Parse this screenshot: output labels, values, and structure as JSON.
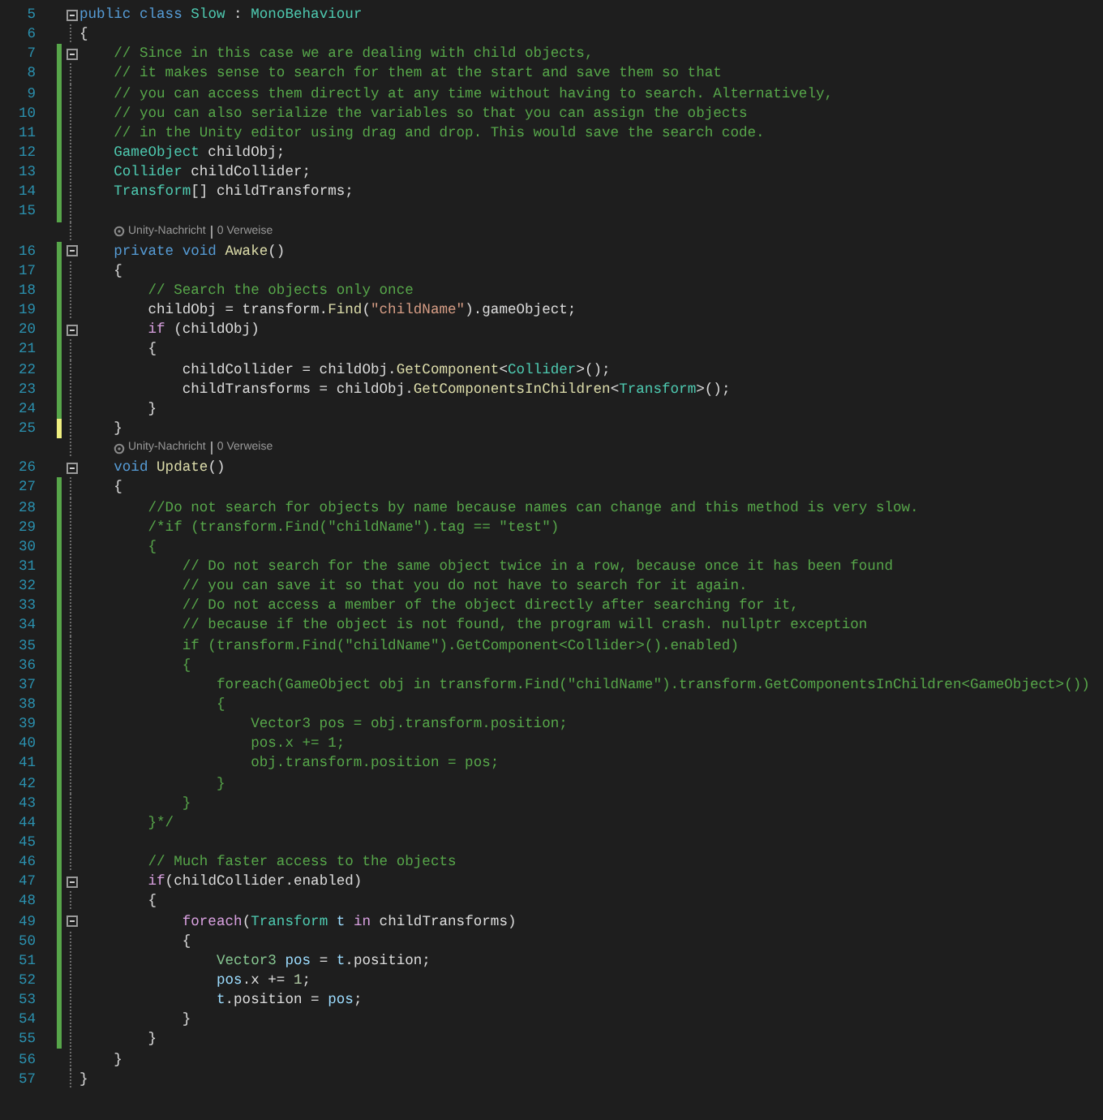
{
  "editor": {
    "rows": [
      {
        "kind": "code",
        "number": "5",
        "fold": true,
        "tokens": [
          {
            "kind": "keyword",
            "text": "public class "
          },
          {
            "kind": "type",
            "text": "Slow"
          },
          {
            "kind": "plain",
            "text": " : "
          },
          {
            "kind": "type",
            "text": "MonoBehaviour"
          }
        ]
      },
      {
        "kind": "code",
        "number": "6",
        "fold": false,
        "tokens": [
          {
            "kind": "plain",
            "text": "{"
          }
        ]
      },
      {
        "kind": "code",
        "number": "7",
        "fold": true,
        "color": "#57a64a",
        "tokens": [
          {
            "kind": "comment",
            "text": "    // Since in this case we are dealing with child objects,"
          }
        ]
      },
      {
        "kind": "code",
        "number": "8",
        "fold": false,
        "color": "#57a64a",
        "tokens": [
          {
            "kind": "comment",
            "text": "    // it makes sense to search for them at the start and save them so that"
          }
        ]
      },
      {
        "kind": "code",
        "number": "9",
        "fold": false,
        "color": "#57a64a",
        "tokens": [
          {
            "kind": "comment",
            "text": "    // you can access them directly at any time without having to search. Alternatively,"
          }
        ]
      },
      {
        "kind": "code",
        "number": "10",
        "fold": false,
        "color": "#57a64a",
        "tokens": [
          {
            "kind": "comment",
            "text": "    // you can also serialize the variables so that you can assign the objects"
          }
        ]
      },
      {
        "kind": "code",
        "number": "11",
        "fold": false,
        "color": "#57a64a",
        "tokens": [
          {
            "kind": "comment",
            "text": "    // in the Unity editor using drag and drop. This would save the search code."
          }
        ]
      },
      {
        "kind": "code",
        "number": "12",
        "fold": false,
        "color": "#57a64a",
        "tokens": [
          {
            "kind": "type",
            "text": "    GameObject"
          },
          {
            "kind": "plain",
            "text": " childObj;"
          }
        ]
      },
      {
        "kind": "code",
        "number": "13",
        "fold": false,
        "color": "#57a64a",
        "tokens": [
          {
            "kind": "type",
            "text": "    Collider"
          },
          {
            "kind": "plain",
            "text": " childCollider;"
          }
        ]
      },
      {
        "kind": "code",
        "number": "14",
        "fold": false,
        "color": "#57a64a",
        "tokens": [
          {
            "kind": "type",
            "text": "    Transform"
          },
          {
            "kind": "plain",
            "text": "[] childTransforms;"
          }
        ]
      },
      {
        "kind": "code",
        "number": "15",
        "fold": false,
        "color": "#57a64a",
        "tokens": []
      },
      {
        "kind": "codelens",
        "source": "Unity-Nachricht",
        "references": "0 Verweise"
      },
      {
        "kind": "code",
        "number": "16",
        "fold": true,
        "color": "#57a64a",
        "tokens": [
          {
            "kind": "keyword",
            "text": "    private void "
          },
          {
            "kind": "method",
            "text": "Awake"
          },
          {
            "kind": "plain",
            "text": "()"
          }
        ]
      },
      {
        "kind": "code",
        "number": "17",
        "fold": false,
        "color": "#57a64a",
        "tokens": [
          {
            "kind": "plain",
            "text": "    {"
          }
        ]
      },
      {
        "kind": "code",
        "number": "18",
        "fold": false,
        "color": "#57a64a",
        "tokens": [
          {
            "kind": "comment",
            "text": "        // Search the objects only once"
          }
        ]
      },
      {
        "kind": "code",
        "number": "19",
        "fold": false,
        "color": "#57a64a",
        "tokens": [
          {
            "kind": "plain",
            "text": "        childObj = transform."
          },
          {
            "kind": "method",
            "text": "Find"
          },
          {
            "kind": "plain",
            "text": "("
          },
          {
            "kind": "string",
            "text": "\"childName\""
          },
          {
            "kind": "plain",
            "text": ").gameObject;"
          }
        ]
      },
      {
        "kind": "code",
        "number": "20",
        "fold": true,
        "color": "#57a64a",
        "tokens": [
          {
            "kind": "control",
            "text": "        if"
          },
          {
            "kind": "plain",
            "text": " (childObj)"
          }
        ]
      },
      {
        "kind": "code",
        "number": "21",
        "fold": false,
        "color": "#57a64a",
        "tokens": [
          {
            "kind": "plain",
            "text": "        {"
          }
        ]
      },
      {
        "kind": "code",
        "number": "22",
        "fold": false,
        "color": "#57a64a",
        "tokens": [
          {
            "kind": "plain",
            "text": "            childCollider = childObj."
          },
          {
            "kind": "method",
            "text": "GetComponent"
          },
          {
            "kind": "plain",
            "text": "<"
          },
          {
            "kind": "type",
            "text": "Collider"
          },
          {
            "kind": "plain",
            "text": ">();"
          }
        ]
      },
      {
        "kind": "code",
        "number": "23",
        "fold": false,
        "color": "#57a64a",
        "tokens": [
          {
            "kind": "plain",
            "text": "            childTransforms = childObj."
          },
          {
            "kind": "method",
            "text": "GetComponentsInChildren"
          },
          {
            "kind": "plain",
            "text": "<"
          },
          {
            "kind": "type",
            "text": "Transform"
          },
          {
            "kind": "plain",
            "text": ">();"
          }
        ]
      },
      {
        "kind": "code",
        "number": "24",
        "fold": false,
        "color": "#57a64a",
        "tokens": [
          {
            "kind": "plain",
            "text": "        }"
          }
        ]
      },
      {
        "kind": "code",
        "number": "25",
        "fold": false,
        "color": "#efef80",
        "tokens": [
          {
            "kind": "plain",
            "text": "    }"
          }
        ]
      },
      {
        "kind": "codelens",
        "source": "Unity-Nachricht",
        "references": "0 Verweise"
      },
      {
        "kind": "code",
        "number": "26",
        "fold": true,
        "tokens": [
          {
            "kind": "keyword",
            "text": "    void "
          },
          {
            "kind": "method",
            "text": "Update"
          },
          {
            "kind": "plain",
            "text": "()"
          }
        ]
      },
      {
        "kind": "code",
        "number": "27",
        "fold": false,
        "color": "#57a64a",
        "tokens": [
          {
            "kind": "plain",
            "text": "    {"
          }
        ]
      },
      {
        "kind": "code",
        "number": "28",
        "fold": false,
        "color": "#57a64a",
        "tokens": [
          {
            "kind": "comment",
            "text": "        //Do not search for objects by name because names can change and this method is very slow."
          }
        ]
      },
      {
        "kind": "code",
        "number": "29",
        "fold": false,
        "color": "#57a64a",
        "tokens": [
          {
            "kind": "comment",
            "text": "        /*if (transform.Find(\"childName\").tag == \"test\")"
          }
        ]
      },
      {
        "kind": "code",
        "number": "30",
        "fold": false,
        "color": "#57a64a",
        "tokens": [
          {
            "kind": "comment",
            "text": "        {"
          }
        ]
      },
      {
        "kind": "code",
        "number": "31",
        "fold": false,
        "color": "#57a64a",
        "tokens": [
          {
            "kind": "comment",
            "text": "            // Do not search for the same object twice in a row, because once it has been found"
          }
        ]
      },
      {
        "kind": "code",
        "number": "32",
        "fold": false,
        "color": "#57a64a",
        "tokens": [
          {
            "kind": "comment",
            "text": "            // you can save it so that you do not have to search for it again."
          }
        ]
      },
      {
        "kind": "code",
        "number": "33",
        "fold": false,
        "color": "#57a64a",
        "tokens": [
          {
            "kind": "comment",
            "text": "            // Do not access a member of the object directly after searching for it,"
          }
        ]
      },
      {
        "kind": "code",
        "number": "34",
        "fold": false,
        "color": "#57a64a",
        "tokens": [
          {
            "kind": "comment",
            "text": "            // because if the object is not found, the program will crash. nullptr exception"
          }
        ]
      },
      {
        "kind": "code",
        "number": "35",
        "fold": false,
        "color": "#57a64a",
        "tokens": [
          {
            "kind": "comment",
            "text": "            if (transform.Find(\"childName\").GetComponent<Collider>().enabled)"
          }
        ]
      },
      {
        "kind": "code",
        "number": "36",
        "fold": false,
        "color": "#57a64a",
        "tokens": [
          {
            "kind": "comment",
            "text": "            {"
          }
        ]
      },
      {
        "kind": "code",
        "number": "37",
        "fold": false,
        "color": "#57a64a",
        "tokens": [
          {
            "kind": "comment",
            "text": "                foreach(GameObject obj in transform.Find(\"childName\").transform.GetComponentsInChildren<GameObject>())"
          }
        ]
      },
      {
        "kind": "code",
        "number": "38",
        "fold": false,
        "color": "#57a64a",
        "tokens": [
          {
            "kind": "comment",
            "text": "                {"
          }
        ]
      },
      {
        "kind": "code",
        "number": "39",
        "fold": false,
        "color": "#57a64a",
        "tokens": [
          {
            "kind": "comment",
            "text": "                    Vector3 pos = obj.transform.position;"
          }
        ]
      },
      {
        "kind": "code",
        "number": "40",
        "fold": false,
        "color": "#57a64a",
        "tokens": [
          {
            "kind": "comment",
            "text": "                    pos.x += 1;"
          }
        ]
      },
      {
        "kind": "code",
        "number": "41",
        "fold": false,
        "color": "#57a64a",
        "tokens": [
          {
            "kind": "comment",
            "text": "                    obj.transform.position = pos;"
          }
        ]
      },
      {
        "kind": "code",
        "number": "42",
        "fold": false,
        "color": "#57a64a",
        "tokens": [
          {
            "kind": "comment",
            "text": "                }"
          }
        ]
      },
      {
        "kind": "code",
        "number": "43",
        "fold": false,
        "color": "#57a64a",
        "tokens": [
          {
            "kind": "comment",
            "text": "            }"
          }
        ]
      },
      {
        "kind": "code",
        "number": "44",
        "fold": false,
        "color": "#57a64a",
        "tokens": [
          {
            "kind": "comment",
            "text": "        }*/"
          }
        ]
      },
      {
        "kind": "code",
        "number": "45",
        "fold": false,
        "color": "#57a64a",
        "tokens": []
      },
      {
        "kind": "code",
        "number": "46",
        "fold": false,
        "color": "#57a64a",
        "tokens": [
          {
            "kind": "comment",
            "text": "        // Much faster access to the objects"
          }
        ]
      },
      {
        "kind": "code",
        "number": "47",
        "fold": true,
        "color": "#57a64a",
        "tokens": [
          {
            "kind": "control",
            "text": "        if"
          },
          {
            "kind": "plain",
            "text": "(childCollider.enabled)"
          }
        ]
      },
      {
        "kind": "code",
        "number": "48",
        "fold": false,
        "color": "#57a64a",
        "tokens": [
          {
            "kind": "plain",
            "text": "        {"
          }
        ]
      },
      {
        "kind": "code",
        "number": "49",
        "fold": true,
        "color": "#57a64a",
        "tokens": [
          {
            "kind": "control",
            "text": "            foreach"
          },
          {
            "kind": "plain",
            "text": "("
          },
          {
            "kind": "type",
            "text": "Transform"
          },
          {
            "kind": "local",
            "text": " t"
          },
          {
            "kind": "control",
            "text": " in"
          },
          {
            "kind": "plain",
            "text": " childTransforms)"
          }
        ]
      },
      {
        "kind": "code",
        "number": "50",
        "fold": false,
        "color": "#57a64a",
        "tokens": [
          {
            "kind": "plain",
            "text": "            {"
          }
        ]
      },
      {
        "kind": "code",
        "number": "51",
        "fold": false,
        "color": "#57a64a",
        "tokens": [
          {
            "kind": "struct",
            "text": "                Vector3"
          },
          {
            "kind": "local",
            "text": " pos"
          },
          {
            "kind": "plain",
            "text": " = "
          },
          {
            "kind": "local",
            "text": "t"
          },
          {
            "kind": "plain",
            "text": ".position;"
          }
        ]
      },
      {
        "kind": "code",
        "number": "52",
        "fold": false,
        "color": "#57a64a",
        "tokens": [
          {
            "kind": "local",
            "text": "                pos"
          },
          {
            "kind": "plain",
            "text": ".x += "
          },
          {
            "kind": "number",
            "text": "1"
          },
          {
            "kind": "plain",
            "text": ";"
          }
        ]
      },
      {
        "kind": "code",
        "number": "53",
        "fold": false,
        "color": "#57a64a",
        "tokens": [
          {
            "kind": "local",
            "text": "                t"
          },
          {
            "kind": "plain",
            "text": ".position = "
          },
          {
            "kind": "local",
            "text": "pos"
          },
          {
            "kind": "plain",
            "text": ";"
          }
        ]
      },
      {
        "kind": "code",
        "number": "54",
        "fold": false,
        "color": "#57a64a",
        "tokens": [
          {
            "kind": "plain",
            "text": "            }"
          }
        ]
      },
      {
        "kind": "code",
        "number": "55",
        "fold": false,
        "color": "#57a64a",
        "tokens": [
          {
            "kind": "plain",
            "text": "        }"
          }
        ]
      },
      {
        "kind": "code",
        "number": "56",
        "fold": false,
        "tokens": [
          {
            "kind": "plain",
            "text": "    }"
          }
        ]
      },
      {
        "kind": "code",
        "number": "57",
        "fold": false,
        "tokens": [
          {
            "kind": "plain",
            "text": "}"
          }
        ]
      }
    ]
  }
}
